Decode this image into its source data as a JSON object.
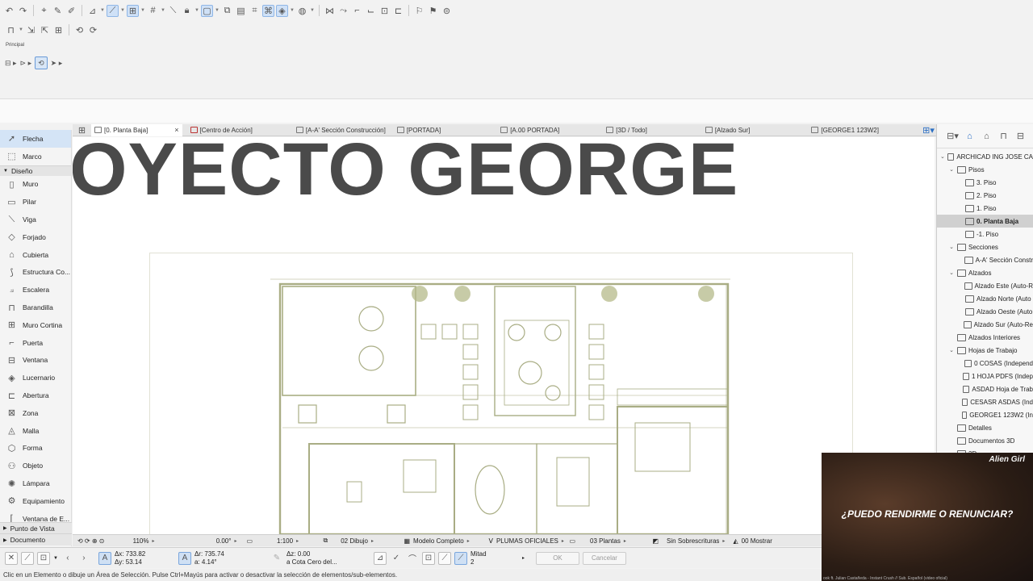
{
  "toolbar": {
    "principal_label": "Principal"
  },
  "tabs": [
    {
      "label": "[0. Planta Baja]",
      "active": true
    },
    {
      "label": "[Centro de Acción]"
    },
    {
      "label": "[A-A' Sección Construcción]"
    },
    {
      "label": "[PORTADA]"
    },
    {
      "label": "[A.00 PORTADA]"
    },
    {
      "label": "[3D / Todo]"
    },
    {
      "label": "[Alzado Sur]"
    },
    {
      "label": "[GEORGE1 123W2]"
    }
  ],
  "toolbox": {
    "top_items": [
      {
        "label": "Flecha",
        "icon": "arrow-icon",
        "active": true
      },
      {
        "label": "Marco",
        "icon": "marquee-icon"
      }
    ],
    "section_diseno": "Diseño",
    "items": [
      {
        "label": "Muro",
        "icon": "wall-icon"
      },
      {
        "label": "Pilar",
        "icon": "column-icon"
      },
      {
        "label": "Viga",
        "icon": "beam-icon"
      },
      {
        "label": "Forjado",
        "icon": "slab-icon"
      },
      {
        "label": "Cubierta",
        "icon": "roof-icon"
      },
      {
        "label": "Estructura Co...",
        "icon": "shell-icon"
      },
      {
        "label": "Escalera",
        "icon": "stair-icon"
      },
      {
        "label": "Barandilla",
        "icon": "railing-icon"
      },
      {
        "label": "Muro Cortina",
        "icon": "curtain-wall-icon"
      },
      {
        "label": "Puerta",
        "icon": "door-icon"
      },
      {
        "label": "Ventana",
        "icon": "window-icon"
      },
      {
        "label": "Lucernario",
        "icon": "skylight-icon"
      },
      {
        "label": "Abertura",
        "icon": "opening-icon"
      },
      {
        "label": "Zona",
        "icon": "zone-icon"
      },
      {
        "label": "Malla",
        "icon": "mesh-icon"
      },
      {
        "label": "Forma",
        "icon": "morph-icon"
      },
      {
        "label": "Objeto",
        "icon": "object-icon"
      },
      {
        "label": "Lámpara",
        "icon": "lamp-icon"
      },
      {
        "label": "Equipamiento",
        "icon": "equipment-icon"
      },
      {
        "label": "Ventana de E...",
        "icon": "corner-window-icon"
      }
    ],
    "section_punto": "Punto de Vista",
    "section_documento": "Documento"
  },
  "canvas": {
    "project_title": "OYECTO GEORGE"
  },
  "navigator": {
    "rows": [
      {
        "label": "ARCHICAD ING JOSE CA",
        "level": 0,
        "chevron": "⌄"
      },
      {
        "label": "Pisos",
        "level": 1,
        "chevron": "⌄"
      },
      {
        "label": "3. Piso",
        "level": 2
      },
      {
        "label": "2. Piso",
        "level": 2
      },
      {
        "label": "1. Piso",
        "level": 2
      },
      {
        "label": "0. Planta Baja",
        "level": 2,
        "active": true
      },
      {
        "label": "-1. Piso",
        "level": 2
      },
      {
        "label": "Secciones",
        "level": 1,
        "chevron": "⌄"
      },
      {
        "label": "A-A' Sección Constr",
        "level": 2
      },
      {
        "label": "Alzados",
        "level": 1,
        "chevron": "⌄"
      },
      {
        "label": "Alzado Este (Auto-R",
        "level": 2
      },
      {
        "label": "Alzado Norte (Auto",
        "level": 2
      },
      {
        "label": "Alzado Oeste (Auto",
        "level": 2
      },
      {
        "label": "Alzado Sur (Auto-Re",
        "level": 2
      },
      {
        "label": "Alzados Interiores",
        "level": 1
      },
      {
        "label": "Hojas de Trabajo",
        "level": 1,
        "chevron": "⌄"
      },
      {
        "label": "0 COSAS (Independ",
        "level": 2
      },
      {
        "label": "1 HOJA PDFS (Indep",
        "level": 2
      },
      {
        "label": "ASDAD Hoja de Trab",
        "level": 2
      },
      {
        "label": "CESASR ASDAS (Ind",
        "level": 2
      },
      {
        "label": "GEORGE1 123W2 (In",
        "level": 2
      },
      {
        "label": "Detalles",
        "level": 1
      },
      {
        "label": "Documentos 3D",
        "level": 1
      },
      {
        "label": "3D",
        "level": 1,
        "chevron": "⌄"
      }
    ]
  },
  "viewbar": {
    "zoom": "110%",
    "angle": "0.00°",
    "scale": "1:100",
    "layer_combo": "02 Dibujo",
    "model_view": "Modelo Completo",
    "pen_set": "PLUMAS OFICIALES",
    "dimension": "03 Plantas",
    "override": "Sin Sobrescrituras",
    "renovation": "00 Mostrar"
  },
  "infobar": {
    "dx": "Δx: 733.82",
    "dy": "Δy: 53.14",
    "dr": "Δr: 735.74",
    "da": "a: 4.14°",
    "dz": "Δz: 0.00",
    "z_ref": "a Cota Cero del...",
    "mitad_label": "Mitad",
    "mitad_value": "2",
    "ok": "OK",
    "cancel": "Cancelar"
  },
  "status_text": "Clic en un Elemento o dibuje un Área de Selección. Pulse Ctrl+Mayús para activar o desactivar la selección de elementos/sub-elementos.",
  "video": {
    "artist": "Alien Girl",
    "title": "¿PUEDO RENDIRME O RENUNCIAR?",
    "credit": "ook ft. Julian Castañeda - Instant Crush // Sub. Español (video oficial)"
  }
}
